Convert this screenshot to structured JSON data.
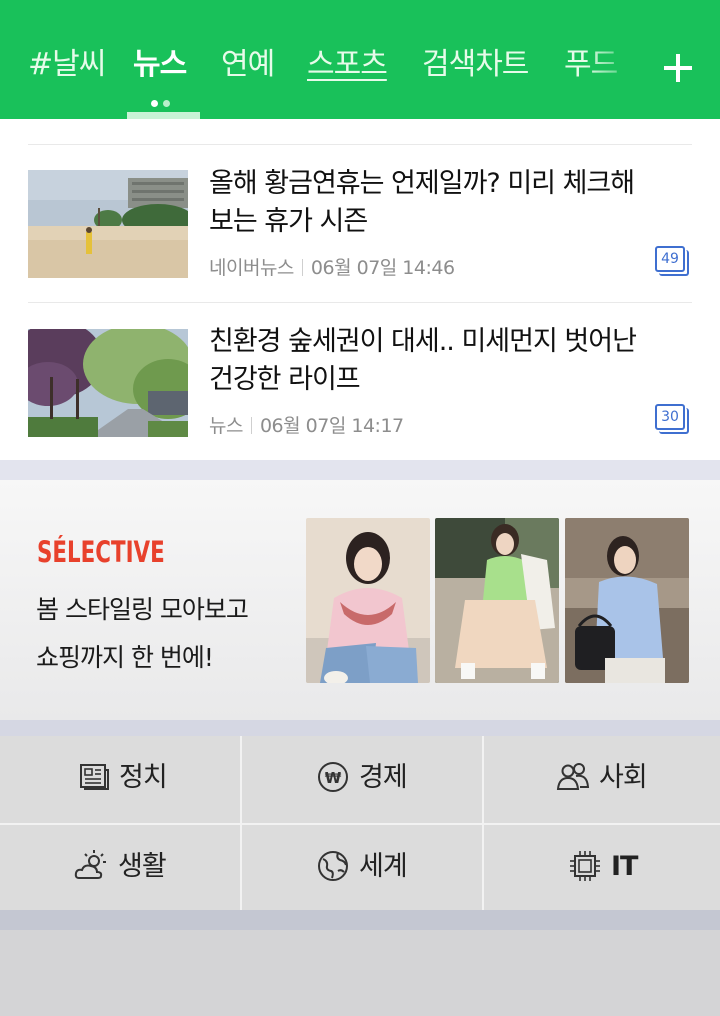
{
  "header": {
    "tabs": [
      {
        "label": "#날씨"
      },
      {
        "label": "뉴스"
      },
      {
        "label": "연예"
      },
      {
        "label": "스포츠"
      },
      {
        "label": "검색차트"
      },
      {
        "label": "푸드"
      }
    ],
    "active_tab": "뉴스",
    "accent_color": "#19c15a"
  },
  "news": {
    "items": [
      {
        "title_line1": "올해 황금연휴는 언제일까? 미리 체크해",
        "title_line2": "보는 휴가 시즌",
        "source": "네이버뉴스",
        "datetime": "06월 07일 14:46",
        "comments": "49"
      },
      {
        "title_line1": "친환경 숲세권이 대세.. 미세먼지 벗어난",
        "title_line2": "건강한 라이프",
        "source": "뉴스",
        "datetime": "06월 07일 14:17",
        "comments": "30"
      }
    ]
  },
  "ad": {
    "brand": "SÉLECTIVE",
    "line1": "봄 스타일링 모아보고",
    "line2": "쇼핑까지 한 번에!",
    "brand_color": "#e8412c"
  },
  "categories": [
    {
      "label": "정치",
      "icon": "newspaper-icon"
    },
    {
      "label": "경제",
      "icon": "won-icon"
    },
    {
      "label": "사회",
      "icon": "people-icon"
    },
    {
      "label": "생활",
      "icon": "weather-icon"
    },
    {
      "label": "세계",
      "icon": "globe-icon"
    },
    {
      "label": "IT",
      "icon": "chip-icon"
    }
  ]
}
